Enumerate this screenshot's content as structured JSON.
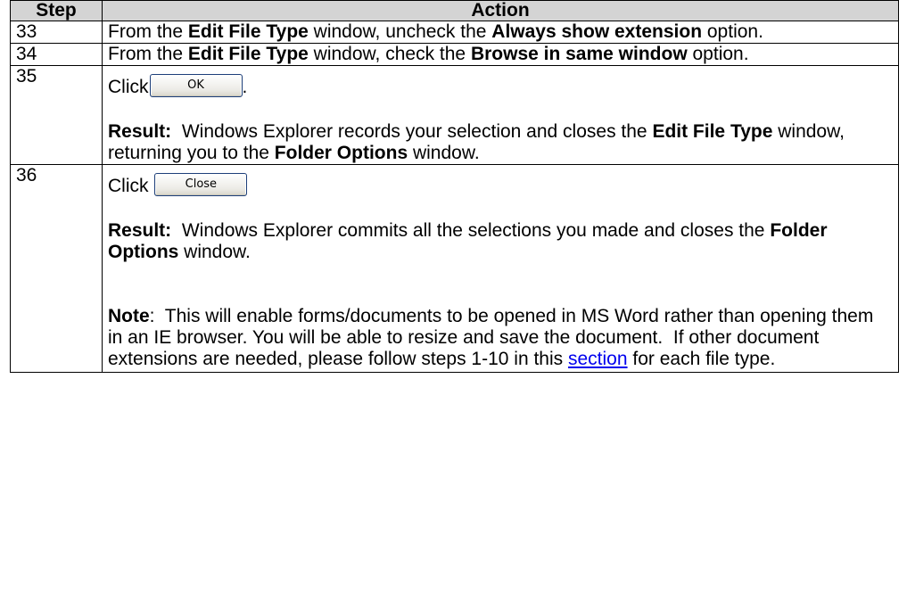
{
  "table": {
    "headers": {
      "step": "Step",
      "action": "Action"
    },
    "rows": [
      {
        "step": "33",
        "t1": "From the ",
        "b1": "Edit File Type",
        "t2": " window, uncheck the ",
        "b2": "Always show extension",
        "t3": " option."
      },
      {
        "step": "34",
        "t1": "From the ",
        "b1": "Edit File Type",
        "t2": " window, check the ",
        "b2": "Browse in same window",
        "t3": " option."
      },
      {
        "step": "35",
        "click": "Click",
        "button": "OK",
        "after_button": ".",
        "result_label": "Result:",
        "r1": "  Windows Explorer records your selection and closes the ",
        "rb1": "Edit File Type",
        "r2": " window, returning you to the ",
        "rb2": "Folder Options",
        "r3": " window."
      },
      {
        "step": "36",
        "click": "Click",
        "button": "Close",
        "result_label": "Result:",
        "r1": "  Windows Explorer commits all the selections you made and closes the ",
        "rb1": "Folder Options",
        "r2": " window.",
        "note_label": "Note",
        "n1": ":  This will enable forms/documents to be opened in MS Word rather than opening them in an IE browser. You will be able to resize and save the document.  If other document extensions are needed, please follow steps 1-10 in this ",
        "link": "section",
        "n2": " for each file type."
      }
    ]
  }
}
